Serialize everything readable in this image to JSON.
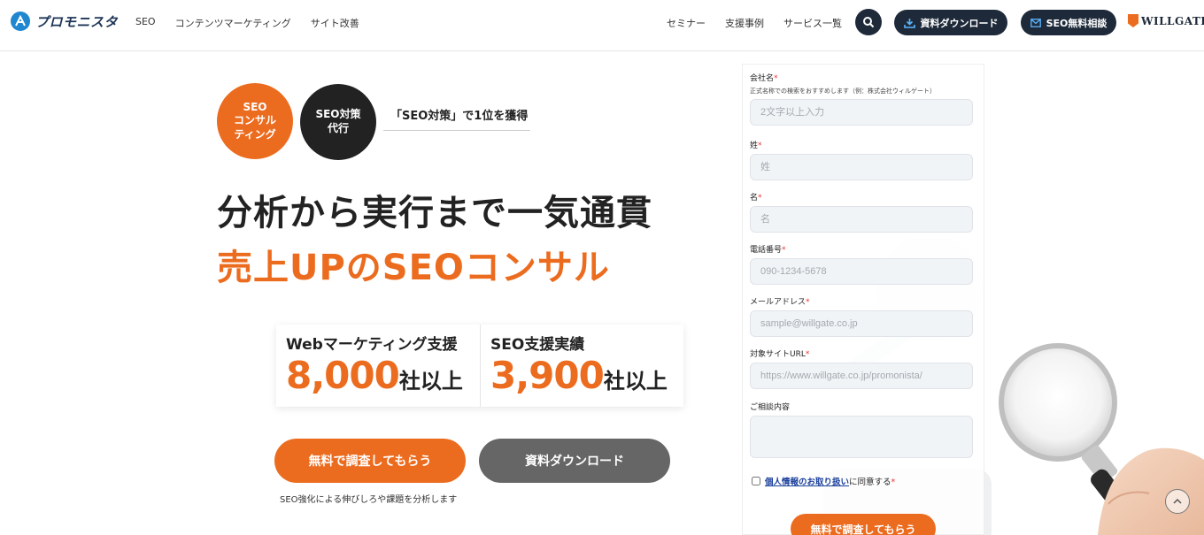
{
  "header": {
    "logo_text": "プロモニスタ",
    "nav_left": [
      "SEO",
      "コンテンツマーケティング",
      "サイト改善"
    ],
    "nav_right": [
      "セミナー",
      "支援事例",
      "サービス一覧"
    ],
    "download_label": "資料ダウンロード",
    "consult_label": "SEO無料相談",
    "brand_logo": "WILLGATE",
    "search_icon": "search-icon"
  },
  "hero": {
    "badge_1": "SEO\nコンサル\nティング",
    "badge_2": "SEO対策\n代行",
    "tagline": "「SEO対策」で1位を獲得",
    "headline_1": "分析から実行まで一気通貫",
    "headline_2": "売上UPのSEOコンサル",
    "stats": [
      {
        "label": "Webマーケティング支援",
        "number": "8,000",
        "unit": "社以上"
      },
      {
        "label": "SEO支援実績",
        "number": "3,900",
        "unit": "社以上"
      }
    ],
    "cta_primary": "無料で調査してもらう",
    "cta_secondary": "資料ダウンロード",
    "cta_note": "SEO強化による伸びしろや課題を分析します"
  },
  "form": {
    "company": {
      "label": "会社名",
      "hint": "正式名称での検索をおすすめします（例：株式会社ウィルゲート）",
      "placeholder": "2文字以上入力"
    },
    "last_name": {
      "label": "姓",
      "placeholder": "姓"
    },
    "first_name": {
      "label": "名",
      "placeholder": "名"
    },
    "phone": {
      "label": "電話番号",
      "placeholder": "090-1234-5678"
    },
    "email": {
      "label": "メールアドレス",
      "placeholder": "sample@willgate.co.jp"
    },
    "site_url": {
      "label": "対象サイトURL",
      "placeholder": "https://www.willgate.co.jp/promonista/"
    },
    "inquiry": {
      "label": "ご相談内容"
    },
    "required_mark": "*",
    "privacy_link": "個人情報のお取り扱い",
    "privacy_suffix": "に同意する",
    "submit_label": "無料で調査してもらう"
  },
  "colors": {
    "accent": "#ec6c1f",
    "navy": "#1e2a3a",
    "gray_button": "#666666",
    "link": "#1a3f9a"
  }
}
